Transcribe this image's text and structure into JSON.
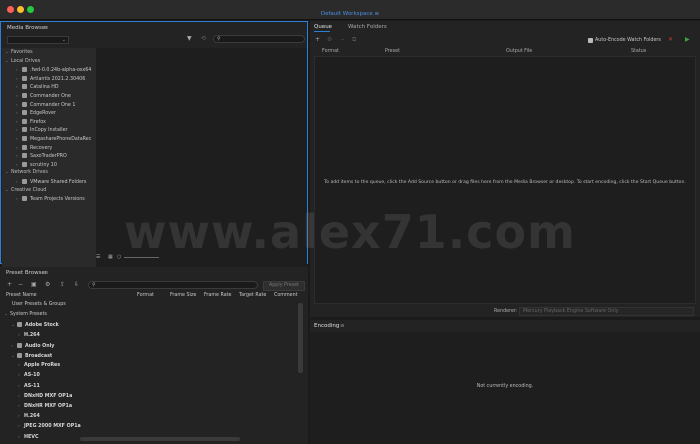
{
  "window": {
    "title": "Default Workspace",
    "title_suffix": "≡"
  },
  "media_browser": {
    "title": "Media Browser",
    "menu": "≡",
    "favorites": "Favorites",
    "local_drives": "Local Drives",
    "drives": [
      ".fwd-0.0.24b-alpha-osx64",
      "Artlantis 2021.2.30406",
      "Catalina HD",
      "Commander One",
      "Commander One 1",
      "EdgeRover",
      "Firefox",
      "InCopy Installer",
      "MegasharePhoneDataRec",
      "Recovery",
      "SaxoTraderPRO",
      "scrutiny 10"
    ],
    "network_drives": "Network Drives",
    "network": [
      "VMware Shared Folders"
    ],
    "creative_cloud": "Creative Cloud",
    "cloud": [
      "Team Projects Versions"
    ]
  },
  "preset_browser": {
    "title": "Preset Browser",
    "menu": "≡",
    "apply_label": "Apply Preset",
    "columns": [
      "Preset Name",
      "Format",
      "Frame Size",
      "Frame Rate",
      "Target Rate",
      "Comment"
    ],
    "rows": [
      {
        "label": "User Presets & Groups",
        "level": 0
      },
      {
        "label": "System Presets",
        "level": 0
      },
      {
        "label": "Adobe Stock",
        "level": 1
      },
      {
        "label": "H.264",
        "level": 2
      },
      {
        "label": "Audio Only",
        "level": 1
      },
      {
        "label": "Broadcast",
        "level": 1
      },
      {
        "label": "Apple ProRes",
        "level": 2
      },
      {
        "label": "AS-10",
        "level": 2
      },
      {
        "label": "AS-11",
        "level": 2
      },
      {
        "label": "DNxHD MXF OP1a",
        "level": 2
      },
      {
        "label": "DNxHR MXF OP1a",
        "level": 2
      },
      {
        "label": "H.264",
        "level": 2
      },
      {
        "label": "JPEG 2000 MXF OP1a",
        "level": 2
      },
      {
        "label": "HEVC",
        "level": 2
      }
    ]
  },
  "queue": {
    "tabs": [
      "Queue",
      "Watch Folders"
    ],
    "auto_encode": "Auto-Encode Watch Folders",
    "columns": [
      "Format",
      "Preset",
      "Output File",
      "Status"
    ],
    "empty_message": "To add items to the queue, click the Add Source button or drag files here from the Media Browser or desktop.  To start encoding, click the Start Queue button.",
    "renderer_label": "Renderer:",
    "renderer_value": "Mercury Playback Engine Software Only"
  },
  "encoding": {
    "title": "Encoding",
    "menu": "≡",
    "status": "Not currently encoding."
  },
  "watermark": "www.alex71.com",
  "colors": {
    "accent": "#2d7fd6",
    "start": "#3fa33f",
    "stop": "#c83b3b"
  }
}
